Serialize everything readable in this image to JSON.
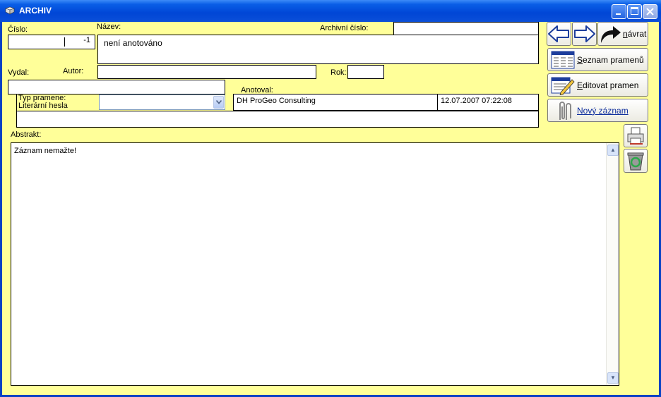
{
  "window": {
    "title": "ARCHIV",
    "icon": "app-book-icon"
  },
  "form": {
    "cislo_label": "Číslo:",
    "cislo_value": "-1",
    "nazev_label": "Název:",
    "nazev_value": "není anotováno",
    "archivni_label": "Archivní číslo:",
    "archivni_value": "",
    "vydal_label": "Vydal:",
    "vydal_value": "",
    "autor_label": "Autor:",
    "autor_value": "",
    "rok_label": "Rok:",
    "rok_value": "",
    "typ_label": "Typ pramene:",
    "literarni_label": "Literární hesla",
    "typ_value": "",
    "literarni_value": "",
    "anotoval_label": "Anotoval:",
    "anotoval_value": "DH ProGeo Consulting",
    "anotoval_date": "12.07.2007 07:22:08",
    "abstrakt_label": "Abstrakt:",
    "abstrakt_value": "Záznam nemažte!"
  },
  "buttons": {
    "back_icon": "arrow-left-icon",
    "forward_icon": "arrow-right-icon",
    "navrat_prefix": "n",
    "navrat_rest": "ávrat",
    "seznam_prefix": "S",
    "seznam_rest": "eznam pramenů",
    "editovat_prefix": "E",
    "editovat_rest": "ditovat pramen",
    "novy_prefix": "N",
    "novy_rest": "ový záznam",
    "print_icon": "printer-icon",
    "delete_icon": "recycle-bin-icon"
  },
  "colors": {
    "form_bg": "#ffff99",
    "titlebar": "#0a5ee6"
  }
}
